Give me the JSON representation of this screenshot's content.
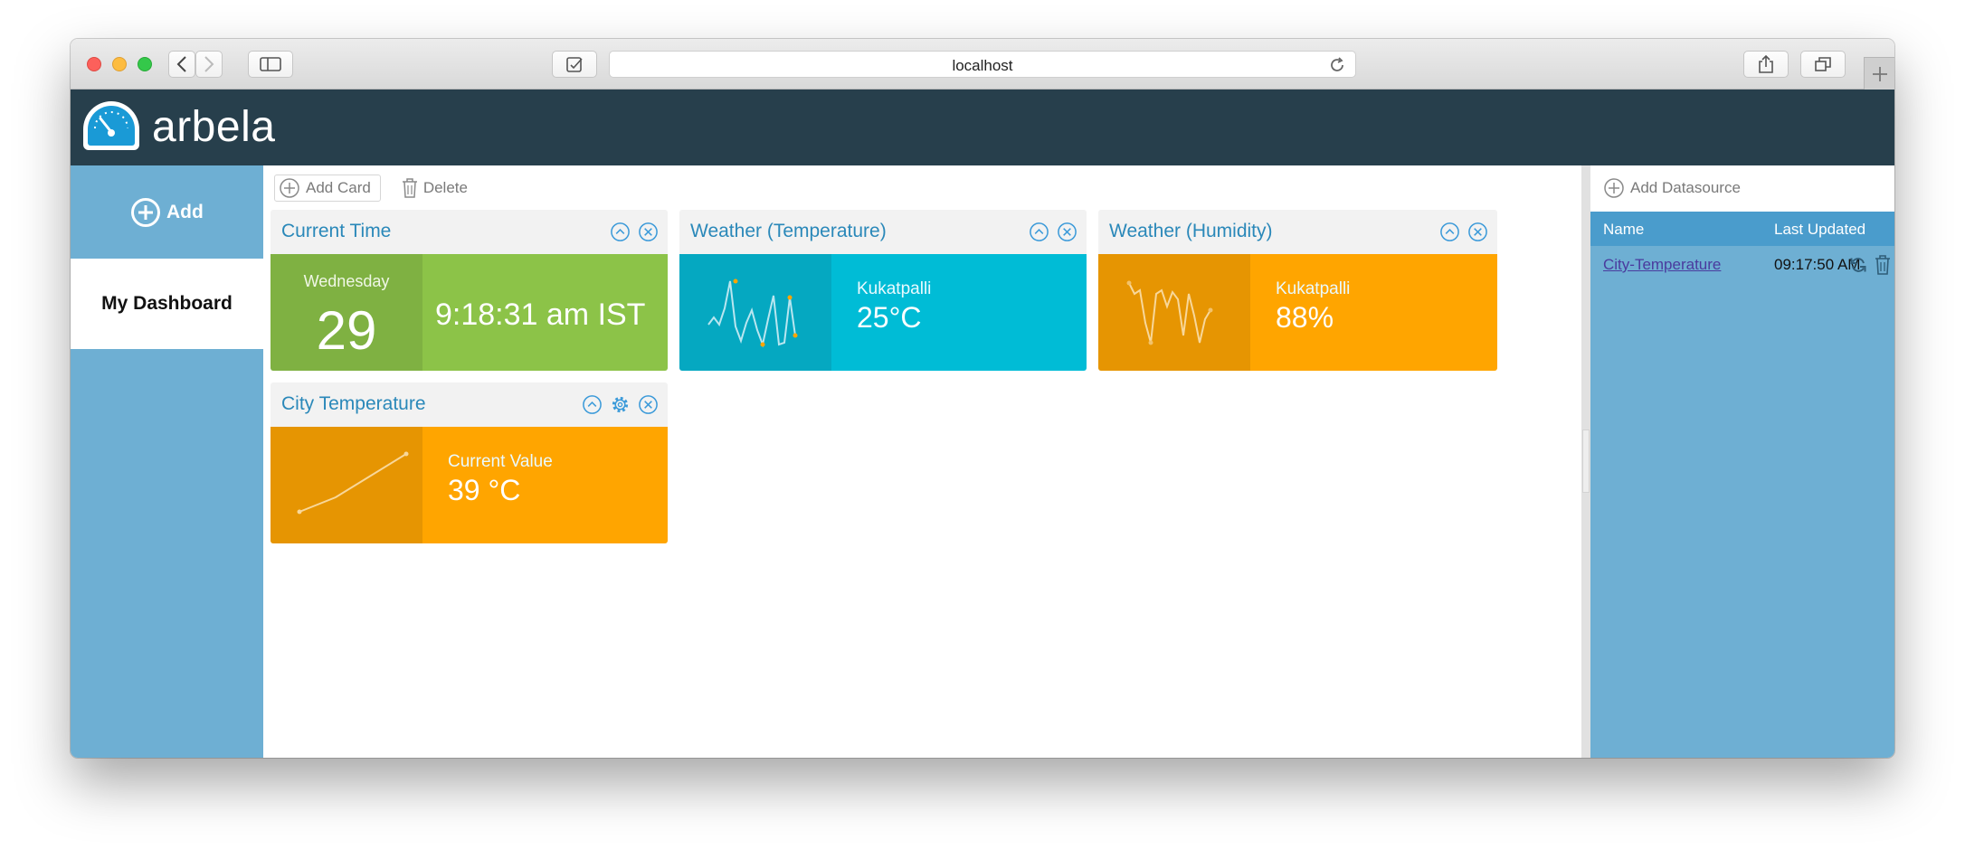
{
  "browser": {
    "url": "localhost"
  },
  "app": {
    "brand": "arbela"
  },
  "sidebar": {
    "add_label": "Add",
    "items": [
      {
        "label": "My Dashboard",
        "selected": true
      }
    ]
  },
  "toolbar": {
    "add_card_label": "Add Card",
    "delete_label": "Delete"
  },
  "cards": {
    "current_time": {
      "title": "Current Time",
      "day_name": "Wednesday",
      "day_number": "29",
      "time": "9:18:31 am IST"
    },
    "weather_temperature": {
      "title": "Weather (Temperature)",
      "location": "Kukatpalli",
      "value": "25°C"
    },
    "weather_humidity": {
      "title": "Weather (Humidity)",
      "location": "Kukatpalli",
      "value": "88%"
    },
    "city_temperature": {
      "title": "City Temperature",
      "label": "Current Value",
      "value": "39 °C"
    }
  },
  "datasources": {
    "add_label": "Add Datasource",
    "columns": [
      "Name",
      "Last Updated"
    ],
    "rows": [
      {
        "name": "City-Temperature",
        "last_updated": "09:17:50 AM"
      }
    ]
  },
  "colors": {
    "header_bg": "#273f4c",
    "sidebar_bg": "#6eafd3",
    "accent_text": "#2a88b9",
    "green": "#8cc348",
    "teal": "#00bcd6",
    "orange": "#ffa500"
  },
  "icons": [
    "back-icon",
    "forward-icon",
    "sidebar-toggle-icon",
    "notes-icon",
    "reload-icon",
    "share-icon",
    "tabs-icon",
    "new-tab-icon",
    "speedometer-logo-icon",
    "plus-circle-icon",
    "trash-icon",
    "collapse-icon",
    "close-icon",
    "gear-icon",
    "refresh-icon"
  ]
}
